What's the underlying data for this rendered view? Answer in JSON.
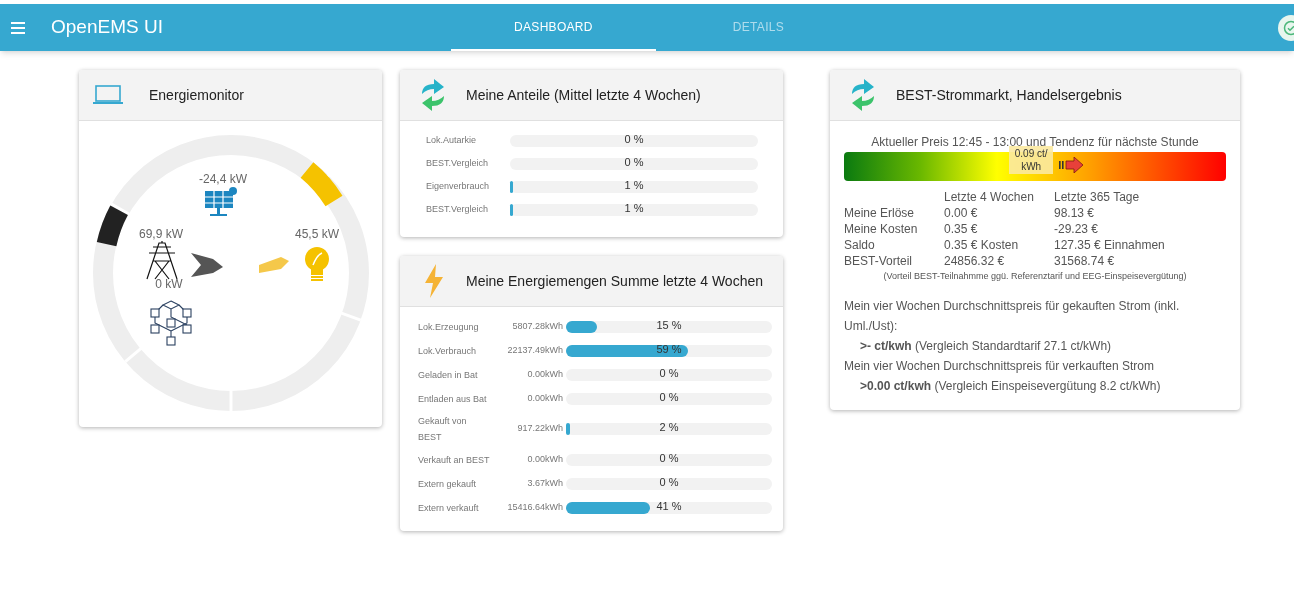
{
  "app_bar": {
    "title": "OpenEMS UI",
    "tabs": [
      {
        "label": "DASHBOARD",
        "selected": true
      },
      {
        "label": "DETAILS",
        "selected": false
      }
    ]
  },
  "energy_monitor": {
    "title": "Energiemonitor",
    "production": "-24,4 kW",
    "grid": "69,9 kW",
    "consumption": "45,5 kW",
    "storage": "0 kW"
  },
  "shares": {
    "title": "Meine Anteile (Mittel letzte 4 Wochen)",
    "rows": [
      {
        "label": "Lok.Autarkie",
        "level": 0,
        "reading": "0 %"
      },
      {
        "label": "BEST.Vergleich",
        "level": 0,
        "reading": "0 %"
      },
      {
        "label": "Eigenverbrauch",
        "level": 0.01,
        "reading": "1 %"
      },
      {
        "label": "BEST.Vergleich",
        "level": 0.01,
        "reading": "1 %"
      }
    ]
  },
  "amounts": {
    "title": "Meine Energiemengen Summe letzte 4 Wochen",
    "rows": [
      {
        "label": "Lok.Erzeugung",
        "value": "5807.28kWh",
        "level": 0.15,
        "reading": "15 %"
      },
      {
        "label": "Lok.Verbrauch",
        "value": "22137.49kWh",
        "level": 0.59,
        "reading": "59 %"
      },
      {
        "label": "Geladen in Bat",
        "value": "0.00kWh",
        "level": 0,
        "reading": "0 %"
      },
      {
        "label": "Entladen aus Bat",
        "value": "0.00kWh",
        "level": 0,
        "reading": "0 %"
      },
      {
        "label": "Gekauft von BEST",
        "value": "917.22kWh",
        "level": 0.02,
        "reading": "2 %"
      },
      {
        "label": "Verkauft an BEST",
        "value": "0.00kWh",
        "level": 0,
        "reading": "0 %"
      },
      {
        "label": "Extern gekauft",
        "value": "3.67kWh",
        "level": 0,
        "reading": "0 %"
      },
      {
        "label": "Extern verkauft",
        "value": "15416.64kWh",
        "level": 0.41,
        "reading": "41 %"
      }
    ]
  },
  "market": {
    "title": "BEST-Strommarkt, Handelsergebnis",
    "price_caption": "Aktueller Preis 12:45 - 13:00 und Tendenz für nächste Stunde",
    "price": {
      "label": "0.09 ct/ kWh"
    },
    "columns": [
      "Letzte 4 Wochen",
      "Letzte 365 Tage"
    ],
    "rows": [
      {
        "label": "Meine Erlöse",
        "values": [
          "0.00 €",
          "98.13 €"
        ]
      },
      {
        "label": "Meine Kosten",
        "values": [
          "0.35 €",
          "-29.23 €"
        ]
      },
      {
        "label": "Saldo",
        "values": [
          "0.35 € Kosten",
          "127.35 € Einnahmen"
        ]
      },
      {
        "label": "BEST-Vorteil",
        "values": [
          "24856.32 €",
          "31568.74 €"
        ]
      }
    ],
    "footnote": "(Vorteil BEST-Teilnahmme ggü. Referenztarif und EEG-Einspeisevergütung)",
    "averages": [
      {
        "kind": "heading",
        "text": "Mein vier Wochen Durchschnittspreis für gekauften Strom (inkl. Uml./Ust):"
      },
      {
        "kind": "value",
        "text": "**>- ct/kwh** (Vergleich Standardtarif 27.1 ct/kWh)"
      },
      {
        "kind": "heading",
        "text": "Mein vier Wochen Durchschnittspreis für verkauften Strom"
      },
      {
        "kind": "value",
        "text": "**>0.00 ct/kwh** (Vergleich Einspeisevergütung 8.2 ct/kWh)"
      }
    ]
  }
}
